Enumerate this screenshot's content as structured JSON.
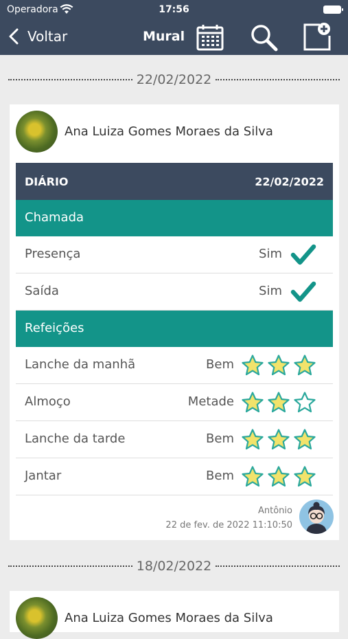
{
  "status_bar": {
    "carrier": "Operadora",
    "time": "17:56"
  },
  "navbar": {
    "back_label": "Voltar",
    "title": "Mural",
    "icons": [
      "calendar-icon",
      "search-icon",
      "new-post-icon"
    ]
  },
  "feed": [
    {
      "date": "22/02/2022",
      "student_name": "Ana Luiza Gomes Moraes da Silva",
      "diary": {
        "header_label": "DIÁRIO",
        "header_date": "22/02/2022",
        "attendance_title": "Chamada",
        "attendance": [
          {
            "label": "Presença",
            "value": "Sim",
            "checked": true
          },
          {
            "label": "Saída",
            "value": "Sim",
            "checked": true
          }
        ],
        "meals_title": "Refeições",
        "meals": [
          {
            "label": "Lanche da manhã",
            "value": "Bem",
            "stars": 3
          },
          {
            "label": "Almoço",
            "value": "Metade",
            "stars": 2
          },
          {
            "label": "Lanche da tarde",
            "value": "Bem",
            "stars": 3
          },
          {
            "label": "Jantar",
            "value": "Bem",
            "stars": 3
          }
        ],
        "stars_max": 3
      },
      "author": "Antônio",
      "timestamp": "22 de fev. de 2022 11:10:50"
    },
    {
      "date": "18/02/2022",
      "student_name": "Ana Luiza Gomes Moraes da Silva"
    }
  ],
  "colors": {
    "navy": "#3c4a5f",
    "teal": "#139489",
    "star_fill": "#f2e36b",
    "star_outline": "#2aa89c"
  }
}
